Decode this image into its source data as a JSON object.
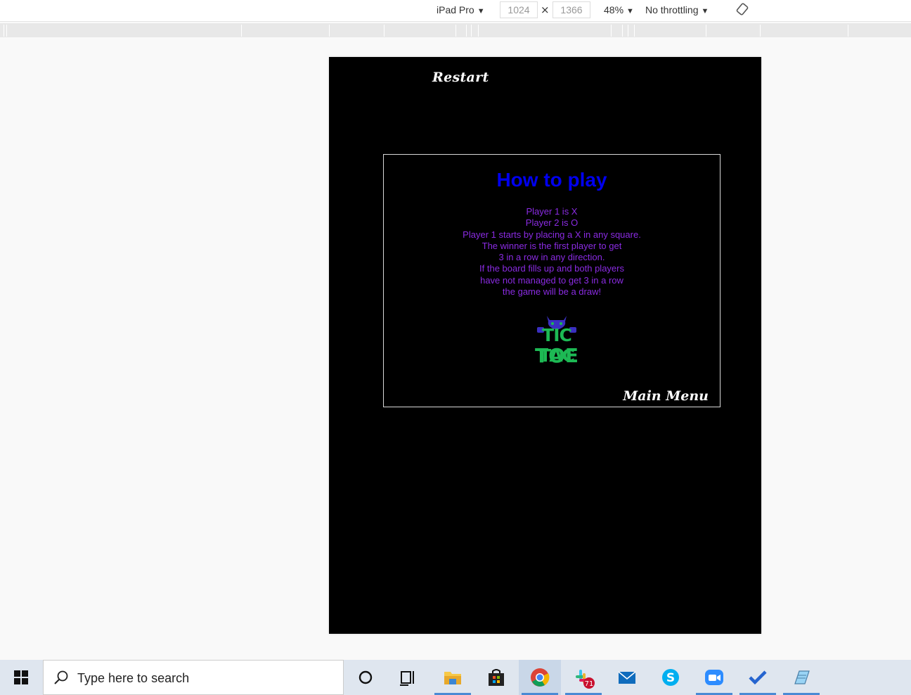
{
  "devtools": {
    "device": "iPad Pro",
    "width": "1024",
    "height": "1366",
    "times": "×",
    "zoom": "48%",
    "throttling": "No throttling"
  },
  "page": {
    "restart_label": "Restart",
    "modal": {
      "title": "How to play",
      "rules": [
        "Player 1 is X",
        "Player 2 is O",
        "Player 1 starts by placing a X in any square.",
        "The winner is the first player to get",
        "3 in a row in any direction.",
        "If the board fills up and both players",
        "have not managed to get 3 in a row",
        "the game will be a draw!"
      ],
      "logo_line1": "TIC TAC",
      "logo_line2": "TOE",
      "main_menu_label": "Main Menu"
    }
  },
  "taskbar": {
    "search_placeholder": "Type here to search",
    "slack_badge": "71"
  }
}
